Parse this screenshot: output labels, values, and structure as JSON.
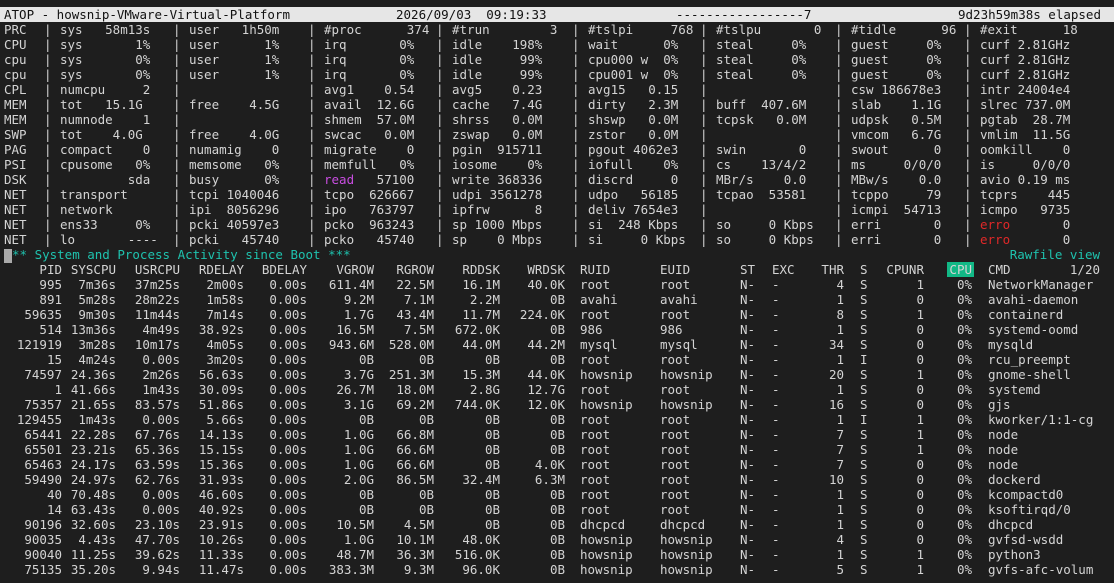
{
  "title_bar": {
    "app": "ATOP - howsnip-VMware-Virtual-Platform",
    "datetime": "2026/09/03  09:19:33",
    "interval": "-----------------7",
    "elapsed": "9d23h59m38s elapsed"
  },
  "system_rows": [
    {
      "label": "PRC",
      "f": [
        "sys   58m13s",
        "user   1h50m",
        "#proc      374",
        "#trun        3",
        "#tslpi     768",
        "#tslpu       0",
        "#tidle      96",
        "#exit      18"
      ]
    },
    {
      "label": "CPU",
      "f": [
        "sys       1%",
        "user      1%",
        "irq       0%",
        "idle    198%",
        "wait      0%",
        "steal     0%",
        "guest     0%",
        "curf 2.81GHz"
      ]
    },
    {
      "label": "cpu",
      "f": [
        "sys       0%",
        "user      1%",
        "irq       0%",
        "idle     99%",
        "cpu000 w  0%",
        "steal     0%",
        "guest     0%",
        "curf 2.81GHz"
      ]
    },
    {
      "label": "cpu",
      "f": [
        "sys       0%",
        "user      1%",
        "irq       0%",
        "idle     99%",
        "cpu001 w  0%",
        "steal     0%",
        "guest     0%",
        "curf 2.81GHz"
      ]
    },
    {
      "label": "CPL",
      "f": [
        "numcpu     2",
        "",
        "avg1    0.54",
        "avg5    0.23",
        "avg15   0.15",
        "",
        "csw 186678e3",
        "intr 24004e4"
      ]
    },
    {
      "label": "MEM",
      "f": [
        "tot   15.1G",
        "free    4.5G",
        "avail  12.6G",
        "cache   7.4G",
        "dirty   2.3M",
        "buff  407.6M",
        "slab    1.1G",
        "slrec 737.0M"
      ]
    },
    {
      "label": "MEM",
      "f": [
        "numnode    1",
        "",
        "shmem  57.0M",
        "shrss   0.0M",
        "shswp   0.0M",
        "tcpsk   0.0M",
        "udpsk   0.5M",
        "pgtab  28.7M"
      ]
    },
    {
      "label": "SWP",
      "f": [
        "tot    4.0G",
        "free    4.0G",
        "swcac   0.0M",
        "zswap   0.0M",
        "zstor   0.0M",
        "",
        "vmcom   6.7G",
        "vmlim  11.5G"
      ]
    },
    {
      "label": "PAG",
      "f": [
        "compact    0",
        "numamig    0",
        "migrate    0",
        "pgin  915711",
        "pgout 4062e3",
        "swin       0",
        "swout      0",
        "oomkill    0"
      ]
    },
    {
      "label": "PSI",
      "f": [
        "cpusome   0%",
        "memsome   0%",
        "memfull   0%",
        "iosome    0%",
        "iofull    0%",
        "cs    13/4/2",
        "ms     0/0/0",
        "is     0/0/0"
      ]
    },
    {
      "label": "DSK",
      "f": [
        "         sda",
        "busy      0%",
        "read   57100",
        "write 368336",
        "discrd     0",
        "MBr/s    0.0",
        "MBw/s    0.0",
        "avio 0.19 ms"
      ]
    },
    {
      "label": "NET",
      "f": [
        "transport",
        "tcpi 1040046",
        "tcpo  626667",
        "udpi 3561278",
        "udpo   56185",
        "tcpao  53581",
        "tcppo     79",
        "tcprs    445"
      ]
    },
    {
      "label": "NET",
      "f": [
        "network",
        "ipi  8056296",
        "ipo   763797",
        "ipfrw      8",
        "deliv 7654e3",
        "",
        "icmpi  54713",
        "icmpo   9735"
      ]
    },
    {
      "label": "NET",
      "f": [
        "ens33     0%",
        "pcki 40597e3",
        "pcko  963243",
        "sp 1000 Mbps",
        "si  248 Kbps",
        "so     0 Kbps",
        "erri       0",
        "erro       0"
      ]
    },
    {
      "label": "NET",
      "f": [
        "lo       ----",
        "pcki   45740",
        "pcko   45740",
        "sp    0 Mbps",
        "si     0 Kbps",
        "so     0 Kbps",
        "erri       0",
        "erro       0"
      ]
    }
  ],
  "banner": {
    "text": "** System and Process Activity since Boot ***",
    "right": "Rawfile view"
  },
  "columns": [
    "PID",
    "SYSCPU",
    "USRCPU",
    "RDELAY",
    "BDELAY",
    "VGROW",
    "RGROW",
    "RDDSK",
    "WRDSK",
    "RUID",
    "EUID",
    "ST",
    "EXC",
    "THR",
    "S",
    "CPUNR",
    "CPU",
    "CMD"
  ],
  "page_indicator": "1/20",
  "processes": [
    [
      "995",
      "7m36s",
      "37m25s",
      "2m00s",
      "0.00s",
      "611.4M",
      "22.5M",
      "16.1M",
      "40.0K",
      "root",
      "root",
      "N-",
      "-",
      "4",
      "S",
      "1",
      "0%",
      "NetworkManager"
    ],
    [
      "891",
      "5m28s",
      "28m22s",
      "1m58s",
      "0.00s",
      "9.2M",
      "7.1M",
      "2.2M",
      "0B",
      "avahi",
      "avahi",
      "N-",
      "-",
      "1",
      "S",
      "0",
      "0%",
      "avahi-daemon"
    ],
    [
      "59635",
      "9m30s",
      "11m44s",
      "7m14s",
      "0.00s",
      "1.7G",
      "43.4M",
      "11.7M",
      "224.0K",
      "root",
      "root",
      "N-",
      "-",
      "8",
      "S",
      "1",
      "0%",
      "containerd"
    ],
    [
      "514",
      "13m36s",
      "4m49s",
      "38.92s",
      "0.00s",
      "16.5M",
      "7.5M",
      "672.0K",
      "0B",
      "986",
      "986",
      "N-",
      "-",
      "1",
      "S",
      "0",
      "0%",
      "systemd-oomd"
    ],
    [
      "121919",
      "3m28s",
      "10m17s",
      "4m05s",
      "0.00s",
      "943.6M",
      "528.0M",
      "44.0M",
      "44.2M",
      "mysql",
      "mysql",
      "N-",
      "-",
      "34",
      "S",
      "0",
      "0%",
      "mysqld"
    ],
    [
      "15",
      "4m24s",
      "0.00s",
      "3m20s",
      "0.00s",
      "0B",
      "0B",
      "0B",
      "0B",
      "root",
      "root",
      "N-",
      "-",
      "1",
      "I",
      "0",
      "0%",
      "rcu_preempt"
    ],
    [
      "74597",
      "24.36s",
      "2m26s",
      "56.63s",
      "0.00s",
      "3.7G",
      "251.3M",
      "15.3M",
      "44.0K",
      "howsnip",
      "howsnip",
      "N-",
      "-",
      "20",
      "S",
      "1",
      "0%",
      "gnome-shell"
    ],
    [
      "1",
      "41.66s",
      "1m43s",
      "30.09s",
      "0.00s",
      "26.7M",
      "18.0M",
      "2.8G",
      "12.7G",
      "root",
      "root",
      "N-",
      "-",
      "1",
      "S",
      "0",
      "0%",
      "systemd"
    ],
    [
      "75357",
      "21.65s",
      "83.57s",
      "51.86s",
      "0.00s",
      "3.1G",
      "69.2M",
      "744.0K",
      "12.0K",
      "howsnip",
      "howsnip",
      "N-",
      "-",
      "16",
      "S",
      "0",
      "0%",
      "gjs"
    ],
    [
      "129455",
      "1m43s",
      "0.00s",
      "5.66s",
      "0.00s",
      "0B",
      "0B",
      "0B",
      "0B",
      "root",
      "root",
      "N-",
      "-",
      "1",
      "I",
      "1",
      "0%",
      "kworker/1:1-cg"
    ],
    [
      "65441",
      "22.28s",
      "67.76s",
      "14.13s",
      "0.00s",
      "1.0G",
      "66.8M",
      "0B",
      "0B",
      "root",
      "root",
      "N-",
      "-",
      "7",
      "S",
      "1",
      "0%",
      "node"
    ],
    [
      "65501",
      "23.21s",
      "65.36s",
      "15.15s",
      "0.00s",
      "1.0G",
      "66.6M",
      "0B",
      "0B",
      "root",
      "root",
      "N-",
      "-",
      "7",
      "S",
      "1",
      "0%",
      "node"
    ],
    [
      "65463",
      "24.17s",
      "63.59s",
      "15.36s",
      "0.00s",
      "1.0G",
      "66.6M",
      "0B",
      "4.0K",
      "root",
      "root",
      "N-",
      "-",
      "7",
      "S",
      "0",
      "0%",
      "node"
    ],
    [
      "59490",
      "24.97s",
      "62.76s",
      "31.93s",
      "0.00s",
      "2.0G",
      "86.5M",
      "32.4M",
      "6.3M",
      "root",
      "root",
      "N-",
      "-",
      "10",
      "S",
      "0",
      "0%",
      "dockerd"
    ],
    [
      "40",
      "70.48s",
      "0.00s",
      "46.60s",
      "0.00s",
      "0B",
      "0B",
      "0B",
      "0B",
      "root",
      "root",
      "N-",
      "-",
      "1",
      "S",
      "0",
      "0%",
      "kcompactd0"
    ],
    [
      "14",
      "63.43s",
      "0.00s",
      "40.92s",
      "0.00s",
      "0B",
      "0B",
      "0B",
      "0B",
      "root",
      "root",
      "N-",
      "-",
      "1",
      "S",
      "0",
      "0%",
      "ksoftirqd/0"
    ],
    [
      "90196",
      "32.60s",
      "23.10s",
      "23.91s",
      "0.00s",
      "10.5M",
      "4.5M",
      "0B",
      "0B",
      "dhcpcd",
      "dhcpcd",
      "N-",
      "-",
      "1",
      "S",
      "0",
      "0%",
      "dhcpcd"
    ],
    [
      "90035",
      "4.43s",
      "47.70s",
      "10.26s",
      "0.00s",
      "1.0G",
      "10.1M",
      "48.0K",
      "0B",
      "howsnip",
      "howsnip",
      "N-",
      "-",
      "4",
      "S",
      "0",
      "0%",
      "gvfsd-wsdd"
    ],
    [
      "90040",
      "11.25s",
      "39.62s",
      "11.33s",
      "0.00s",
      "48.7M",
      "36.3M",
      "516.0K",
      "0B",
      "howsnip",
      "howsnip",
      "N-",
      "-",
      "1",
      "S",
      "1",
      "0%",
      "python3"
    ],
    [
      "75135",
      "35.20s",
      "9.94s",
      "11.47s",
      "0.00s",
      "383.3M",
      "9.3M",
      "96.0K",
      "0B",
      "howsnip",
      "howsnip",
      "N-",
      "-",
      "5",
      "S",
      "1",
      "0%",
      "gvfs-afc-volum"
    ]
  ],
  "colors": {
    "background": "#1e1e1e",
    "text": "#d4d4d4",
    "banner": "#1ec2ae",
    "highlight": "#12b886",
    "error": "#e02828",
    "read": "#c84de0"
  }
}
